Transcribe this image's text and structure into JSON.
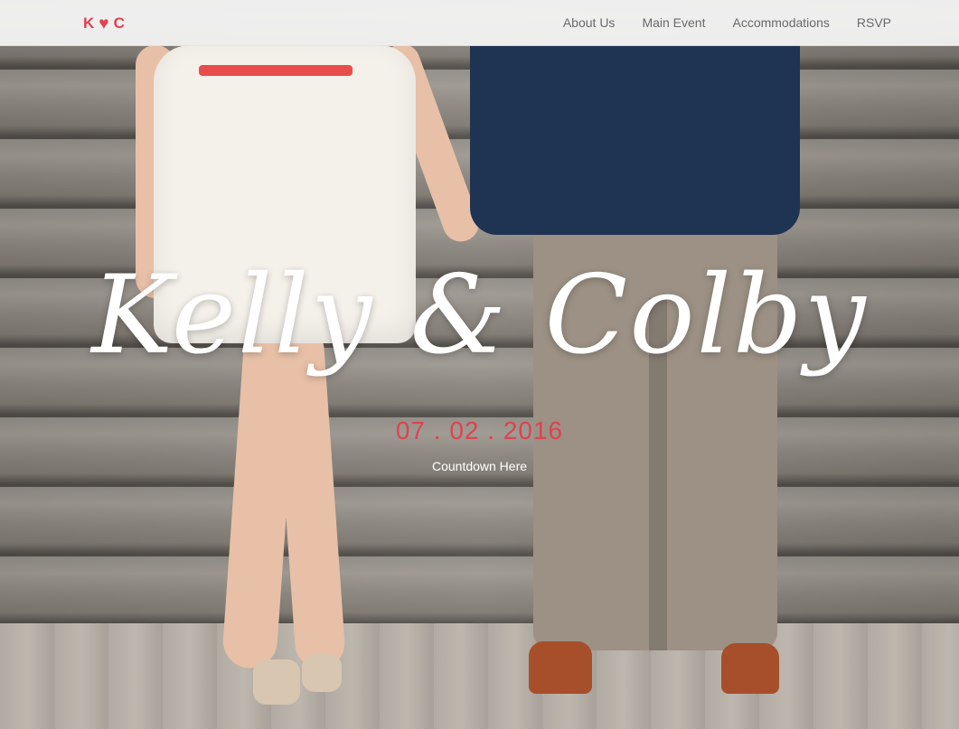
{
  "brand": {
    "left": "K",
    "right": "C",
    "icon": "heart-icon"
  },
  "nav": {
    "items": [
      {
        "label": "About Us"
      },
      {
        "label": "Main Event"
      },
      {
        "label": "Accommodations"
      },
      {
        "label": "RSVP"
      }
    ]
  },
  "hero": {
    "names": "Kelly & Colby",
    "date": "07 . 02 . 2016",
    "countdown": "Countdown Here"
  },
  "colors": {
    "accent": "#e0424f",
    "nav_text": "#6a6a6a"
  }
}
